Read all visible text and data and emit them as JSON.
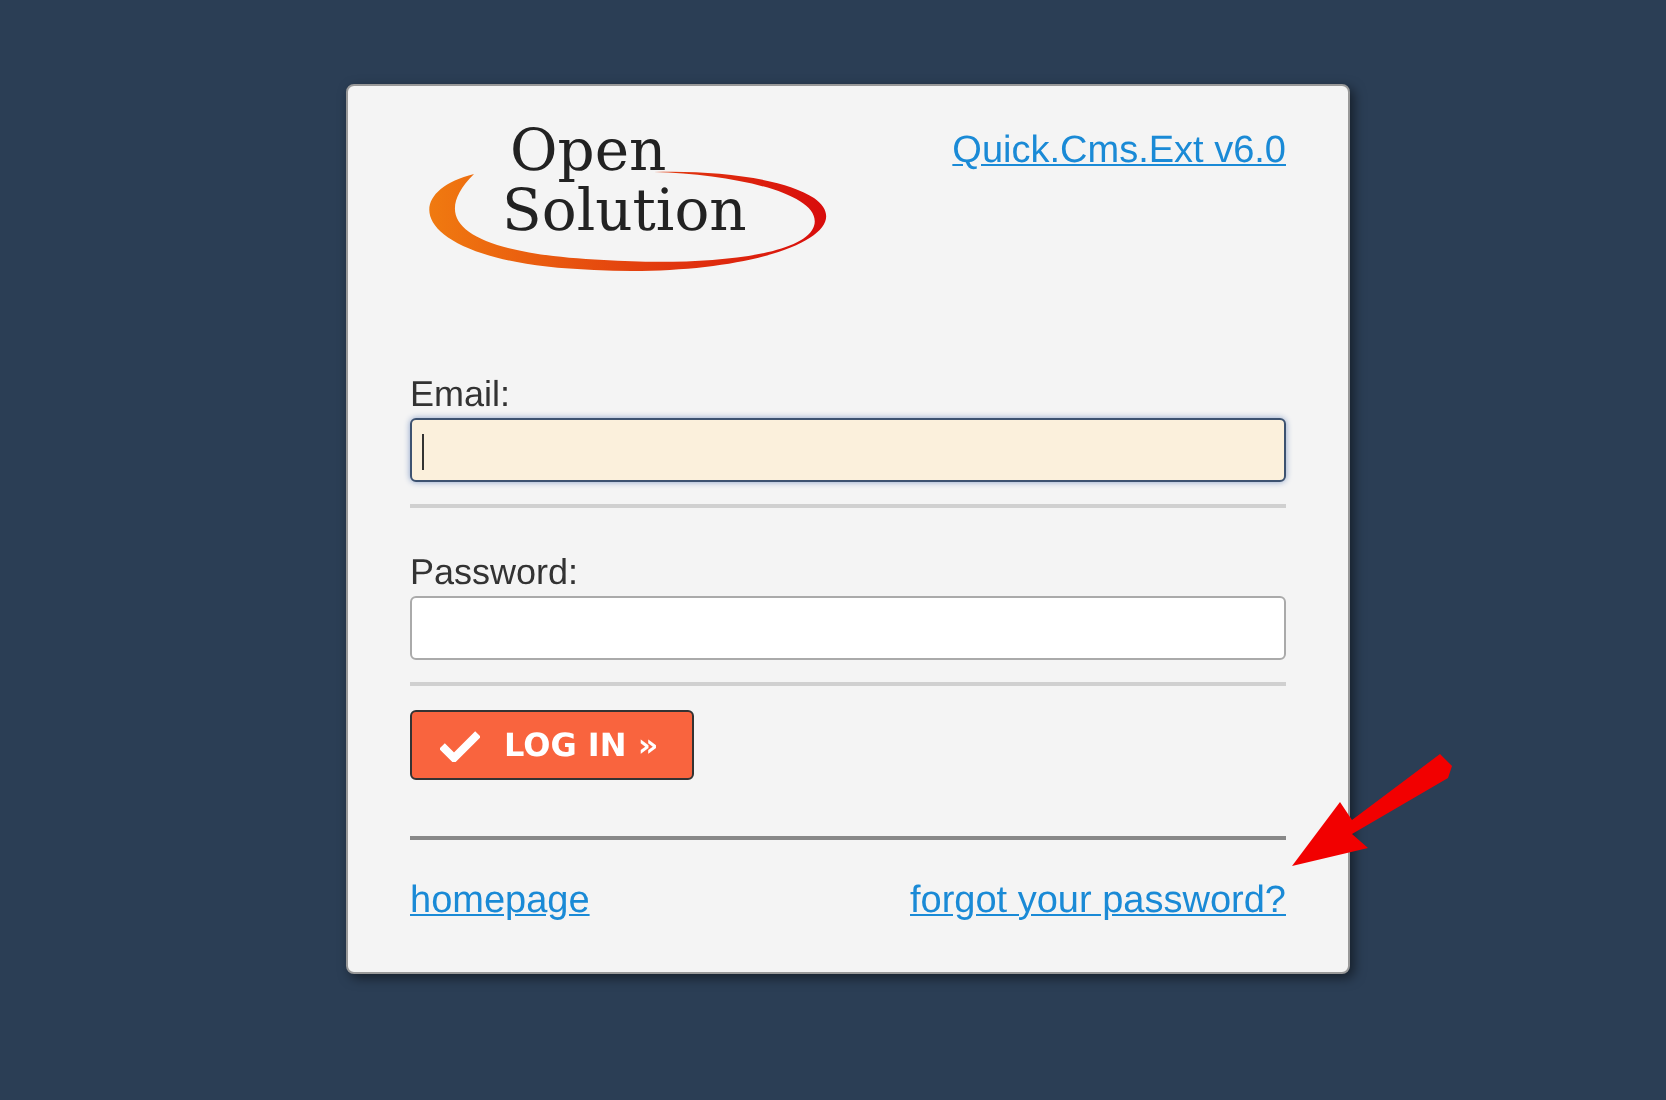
{
  "logo": {
    "lines": [
      "Open",
      "Solution"
    ]
  },
  "version_link": "Quick.Cms.Ext v6.0",
  "fields": [
    {
      "label": "Email:",
      "focused": true
    },
    {
      "label": "Password:",
      "focused": false
    }
  ],
  "login_button": "LOG IN »",
  "links": [
    "homepage",
    "forgot your password?"
  ],
  "annotation_arrow": true
}
